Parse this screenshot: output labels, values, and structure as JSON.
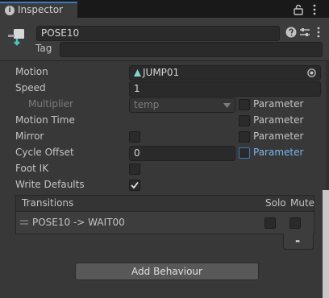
{
  "window": {
    "tab_title": "Inspector",
    "tab_icon": "info-icon",
    "lock_icon": "lock-icon",
    "menu_icon": "kebab-menu-icon"
  },
  "header": {
    "state_icon": "animator-state-icon",
    "name_value": "POSE10",
    "tag_label": "Tag",
    "tag_value": "",
    "help_icon": "help-icon",
    "presets_icon": "presets-icon",
    "menu_icon": "kebab-menu-icon"
  },
  "properties": {
    "motion": {
      "label": "Motion",
      "value": "JUMP01",
      "icon": "animation-clip-icon",
      "picker_icon": "object-picker-icon"
    },
    "speed": {
      "label": "Speed",
      "value": "1"
    },
    "multiplier": {
      "label": "Multiplier",
      "value": "temp",
      "parameter_label": "Parameter",
      "parameter_checked": false
    },
    "motion_time": {
      "label": "Motion Time",
      "parameter_label": "Parameter",
      "parameter_checked": false
    },
    "mirror": {
      "label": "Mirror",
      "checked": false,
      "parameter_label": "Parameter",
      "parameter_checked": false
    },
    "cycle_offset": {
      "label": "Cycle Offset",
      "value": "0",
      "parameter_label": "Parameter",
      "parameter_checked": false
    },
    "foot_ik": {
      "label": "Foot IK",
      "checked": false
    },
    "write_defaults": {
      "label": "Write Defaults",
      "checked": true
    }
  },
  "transitions": {
    "header": "Transitions",
    "solo_label": "Solo",
    "mute_label": "Mute",
    "items": [
      {
        "label": "POSE10 -> WAIT00",
        "solo": false,
        "mute": false
      }
    ],
    "remove_label": "-"
  },
  "add_behaviour_label": "Add Behaviour",
  "colors": {
    "background": "#383838",
    "field": "#2a2a2a",
    "accent": "#3a79bb",
    "highlight_text": "#7cb5ee"
  }
}
